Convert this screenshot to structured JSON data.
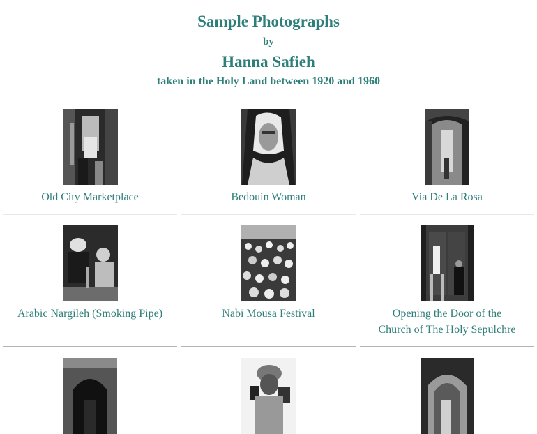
{
  "header": {
    "title": "Sample Photographs",
    "by": "by",
    "author": "Hanna Safieh",
    "subtitle": "taken in the Holy Land between 1920 and 1960"
  },
  "photos": [
    {
      "caption_lines": [
        "Old City Marketplace"
      ]
    },
    {
      "caption_lines": [
        "Bedouin Woman"
      ]
    },
    {
      "caption_lines": [
        "Via De La Rosa"
      ]
    },
    {
      "caption_lines": [
        "Arabic Nargileh (Smoking Pipe)"
      ]
    },
    {
      "caption_lines": [
        "Nabi Mousa Festival"
      ]
    },
    {
      "caption_lines": [
        "Opening the Door of the",
        "Church of The Holy Sepulchre"
      ]
    },
    {
      "caption_lines": []
    },
    {
      "caption_lines": []
    },
    {
      "caption_lines": []
    }
  ]
}
